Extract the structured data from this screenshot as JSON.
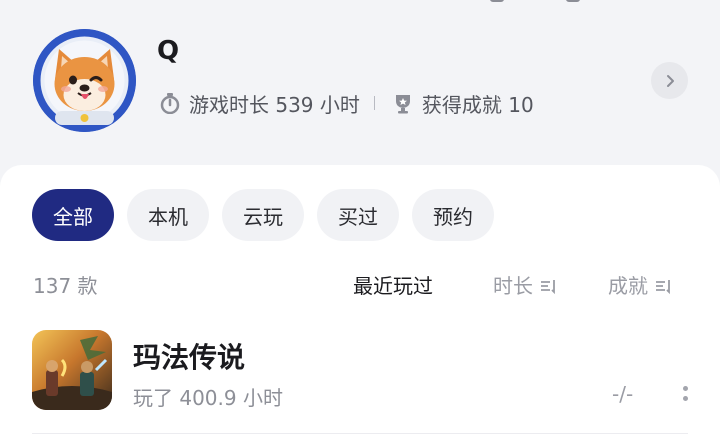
{
  "profile": {
    "username": "Q",
    "playtime": "游戏时长 539 小时",
    "achievements": "获得成就 10",
    "icons": {
      "avatar": "shiba-inu-astronaut-avatar",
      "playtime": "stopwatch-icon",
      "achievements": "trophy-icon",
      "open": "chevron-right-icon"
    }
  },
  "filters": [
    {
      "label": "全部",
      "active": true
    },
    {
      "label": "本机",
      "active": false
    },
    {
      "label": "云玩",
      "active": false
    },
    {
      "label": "买过",
      "active": false
    },
    {
      "label": "预约",
      "active": false
    }
  ],
  "list": {
    "count": "137 款",
    "sort": {
      "recent": "最近玩过",
      "time": "时长",
      "achievements": "成就"
    },
    "games": [
      {
        "title": "玛法传说",
        "played": "玩了 400.9 小时",
        "achievements": "-/-"
      }
    ]
  },
  "colors": {
    "accent": "#202a82",
    "background": "#f3f4f7",
    "card": "#ffffff"
  }
}
